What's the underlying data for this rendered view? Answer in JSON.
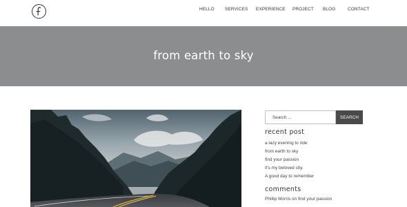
{
  "header": {
    "logo_letter": "f",
    "nav": [
      "HELLO",
      "SERVICES",
      "EXPERIENCE",
      "PROJECT",
      "BLOG",
      "CONTACT"
    ]
  },
  "hero": {
    "title": "from earth to sky"
  },
  "sidebar": {
    "search": {
      "placeholder": "Search ...",
      "button_label": "SEARCH"
    },
    "recent_posts": {
      "title": "recent post",
      "items": [
        "a lazy evening to ride",
        "from earth to sky",
        "find your passion",
        "it's my beloved city.",
        "A good day to remember"
      ]
    },
    "comments": {
      "title": "comments",
      "author": "Phillip Morris",
      "connector": " on ",
      "post": "find your passion"
    }
  },
  "colors": {
    "hero_bg": "#8c8d8f",
    "search_button_bg": "#4a4a4a",
    "text": "#333333"
  }
}
